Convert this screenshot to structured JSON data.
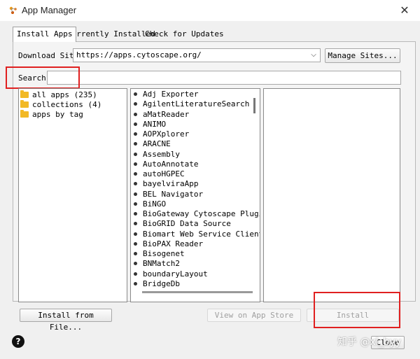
{
  "window": {
    "title": "App Manager"
  },
  "tabs": [
    {
      "label": "Install Apps",
      "active": true
    },
    {
      "label": "Currently Installed",
      "active": false
    },
    {
      "label": "Check for Updates",
      "active": false
    }
  ],
  "download": {
    "label": "Download Site:",
    "site": "https://apps.cytoscape.org/",
    "manage_label": "Manage Sites..."
  },
  "search": {
    "label": "Search:",
    "value": ""
  },
  "tree": [
    {
      "label": "all apps (235)"
    },
    {
      "label": "collections (4)"
    },
    {
      "label": "apps by tag"
    }
  ],
  "apps": [
    "Adj Exporter",
    "AgilentLiteratureSearch",
    "aMatReader",
    "ANIMO",
    "AOPXplorer",
    "ARACNE",
    "Assembly",
    "AutoAnnotate",
    "autoHGPEC",
    "bayelviraApp",
    "BEL Navigator",
    "BiNGO",
    "BioGateway Cytoscape Plugin",
    "BioGRID Data Source",
    "Biomart Web Service Client (",
    "BioPAX Reader",
    "Bisogenet",
    "BNMatch2",
    "boundaryLayout",
    "BridgeDb"
  ],
  "buttons": {
    "install_from_file": "Install from File...",
    "view_store": "View on App Store",
    "install": "Install",
    "close": "Close"
  },
  "watermark": "知乎 @xl_byy",
  "colors": {
    "highlight": "#e02020",
    "folder": "#f2b925",
    "disabled_text": "#a0a0a0"
  },
  "icons": [
    "cytoscape-app-icon",
    "close-icon",
    "dropdown-arrow-icon",
    "folder-icon",
    "help-icon"
  ]
}
